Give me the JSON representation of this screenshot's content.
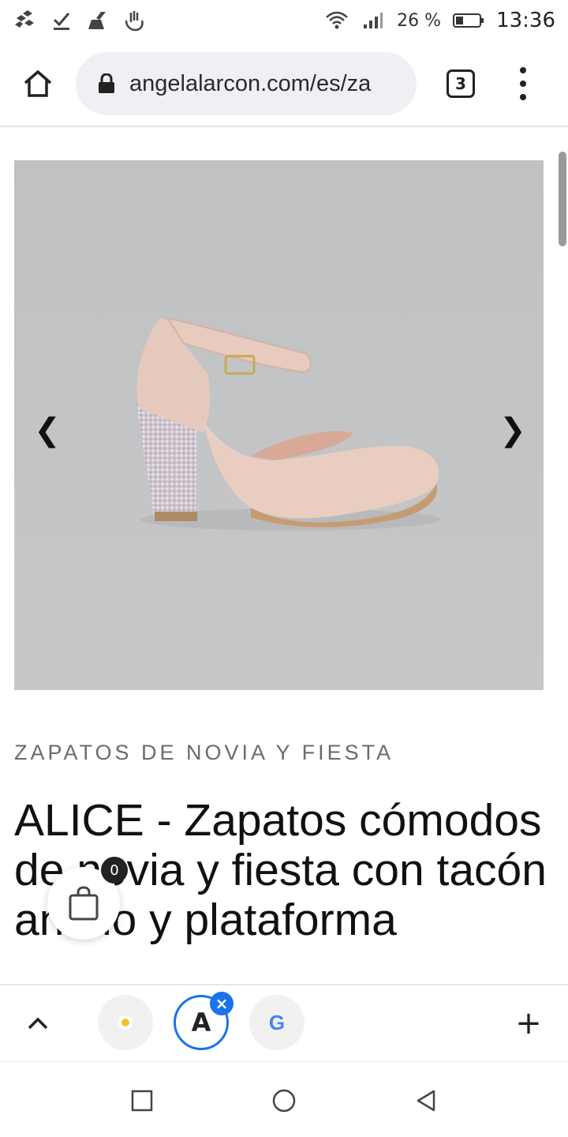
{
  "status_bar": {
    "battery_percent": "26 %",
    "time": "13:36",
    "icons": [
      "gallery-icon",
      "download-done-icon",
      "cleaner-icon",
      "gesture-icon",
      "wifi-icon",
      "signal-icon",
      "battery-icon"
    ]
  },
  "browser": {
    "url": "angelalarcon.com/es/za",
    "tab_count": "3",
    "icons": [
      "home-icon",
      "lock-icon",
      "more-vert-icon"
    ]
  },
  "product": {
    "image_description_icon": "shoe-image",
    "prev_label": "❮",
    "next_label": "❯",
    "category": "ZAPATOS DE NOVIA Y FIESTA",
    "title": "ALICE - Zapatos cómodos de novia y fiesta con tacón ancho y plataforma"
  },
  "cart": {
    "count": "0",
    "icon": "shopping-bag-icon"
  },
  "bottom_bar": {
    "translate_letter": "A",
    "google_letter": "G",
    "close_label": "×",
    "plus_label": "+",
    "icons": [
      "chevron-up-icon",
      "sun-icon",
      "translate-icon",
      "google-icon",
      "add-icon"
    ]
  },
  "colors": {
    "image_bg": "#c3c4c6",
    "accent_blue": "#1a73e8",
    "url_bar_bg": "#eef0f4"
  }
}
